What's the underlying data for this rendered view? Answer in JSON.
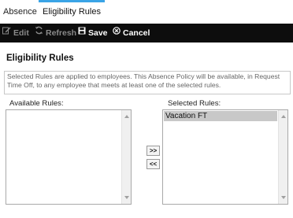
{
  "tabs": [
    {
      "label": "Absence"
    },
    {
      "label": "Eligibility Rules",
      "active": true
    }
  ],
  "toolbar": {
    "edit": "Edit",
    "refresh": "Refresh",
    "save": "Save",
    "cancel": "Cancel"
  },
  "section": {
    "title": "Eligibility Rules",
    "description": "Selected Rules are applied to employees. This Absence Policy will be available, in Request Time Off, to any employee that meets at least one of the selected rules."
  },
  "available": {
    "label": "Available Rules:",
    "items": []
  },
  "selected": {
    "label": "Selected Rules:",
    "items": [
      "Vacation FT"
    ]
  },
  "buttons": {
    "add": ">>",
    "remove": "<<"
  },
  "colors": {
    "tab_accent": "#3aa4e6",
    "toolbar_bg": "#0d0d0d",
    "selected_item_bg": "#c8c8c8"
  }
}
